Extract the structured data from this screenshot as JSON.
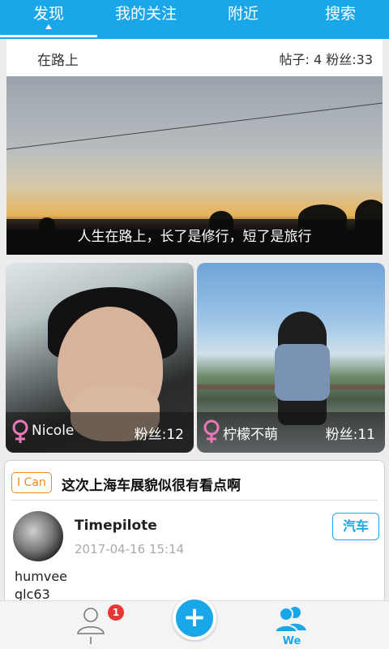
{
  "tabs": [
    {
      "label": "发现",
      "active": true
    },
    {
      "label": "我的关注",
      "active": false
    },
    {
      "label": "附近",
      "active": false
    },
    {
      "label": "搜索",
      "active": false
    }
  ],
  "featured": {
    "title": "在路上",
    "stats": "帖子: 4 粉丝:33",
    "caption": "人生在路上，长了是修行，短了是旅行"
  },
  "profiles": [
    {
      "name": "Nicole",
      "fans": "粉丝:12",
      "gender_icon": "female-icon"
    },
    {
      "name": "柠檬不萌",
      "fans": "粉丝:11",
      "gender_icon": "female-icon"
    }
  ],
  "post": {
    "tag": "I Can",
    "title": "这次上海车展貌似很有看点啊",
    "author": "Timepilote",
    "time": "2017-04-16 15:14",
    "category": "汽车",
    "body_lines": [
      "humvee",
      "glc63"
    ]
  },
  "bottom_nav": {
    "me_label": "I",
    "me_badge": "1",
    "add_label": "+",
    "we_label": "We"
  },
  "colors": {
    "accent": "#1aa7ea",
    "tag_orange": "#f08a1c",
    "badge_red": "#e53935",
    "female_pink": "#e879b6"
  }
}
